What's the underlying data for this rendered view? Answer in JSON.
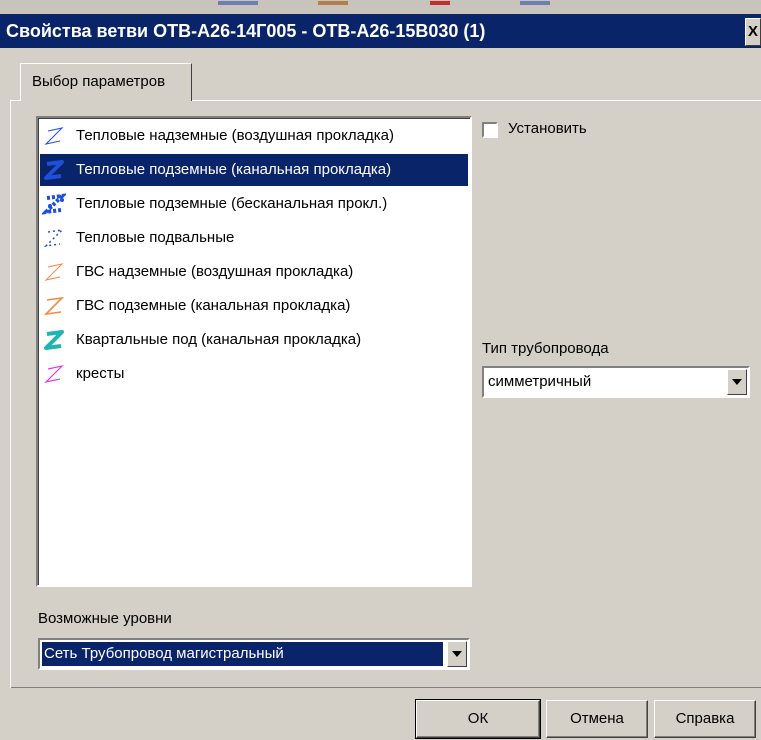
{
  "dialog": {
    "title": "Свойства ветви  ОТВ-А26-14Г005 - ОТВ-А26-15В030 (1)",
    "close_glyph": "X"
  },
  "tab": {
    "label": "Выбор параметров"
  },
  "layers": {
    "items": [
      {
        "label": "Тепловые надземные (воздушная прокладка)",
        "icon": "thin-blue-z-icon",
        "color": "#1e4fd8"
      },
      {
        "label": "Тепловые подземные (канальная прокладка)",
        "icon": "bold-blue-z-icon",
        "color": "#1e4fd8",
        "selected": true
      },
      {
        "label": "Тепловые подземные (бесканальная прокл.)",
        "icon": "dotted-bold-blue-z-icon",
        "color": "#1e4fd8"
      },
      {
        "label": "Тепловые подвальные",
        "icon": "dashed-blue-z-icon",
        "color": "#1e4fd8"
      },
      {
        "label": "ГВС надземные (воздушная прокладка)",
        "icon": "thin-orange-z-icon",
        "color": "#f08a4b"
      },
      {
        "label": "ГВС подземные (канальная прокладка)",
        "icon": "orange-z-icon",
        "color": "#f08a4b"
      },
      {
        "label": "Квартальные под (канальная прокладка)",
        "icon": "bold-teal-z-icon",
        "color": "#1fb5b0"
      },
      {
        "label": "кресты",
        "icon": "magenta-z-icon",
        "color": "#e040e0"
      }
    ]
  },
  "install": {
    "label": "Установить",
    "checked": false
  },
  "pipe_type": {
    "label": "Тип трубопровода",
    "value": "симметричный"
  },
  "levels": {
    "label": "Возможные уровни",
    "value": "Сеть Трубопровод магистральный"
  },
  "buttons": {
    "ok": "ОК",
    "cancel": "Отмена",
    "help": "Справка"
  },
  "colors": {
    "title_bar": "#0a246a",
    "face": "#d4d0c8",
    "selection": "#0a246a"
  }
}
